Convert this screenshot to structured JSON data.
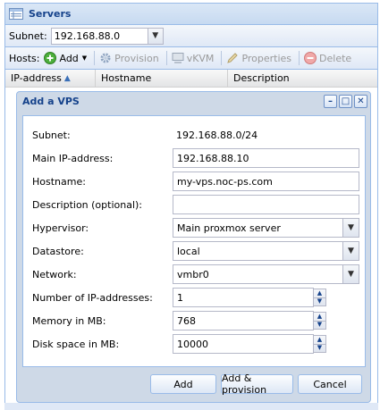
{
  "panel": {
    "title": "Servers"
  },
  "subnet_bar": {
    "label": "Subnet:",
    "value": "192.168.88.0"
  },
  "toolbar": {
    "hosts_label": "Hosts:",
    "add_label": "Add",
    "provision_label": "Provision",
    "vkvm_label": "vKVM",
    "properties_label": "Properties",
    "delete_label": "Delete"
  },
  "grid": {
    "columns": [
      "IP-address",
      "Hostname",
      "Description"
    ]
  },
  "dialog": {
    "title": "Add a VPS",
    "fields": {
      "subnet": {
        "label": "Subnet:",
        "value": "192.168.88.0/24"
      },
      "main_ip": {
        "label": "Main IP-address:",
        "value": "192.168.88.10"
      },
      "hostname": {
        "label": "Hostname:",
        "value": "my-vps.noc-ps.com"
      },
      "description": {
        "label": "Description (optional):",
        "value": ""
      },
      "hypervisor": {
        "label": "Hypervisor:",
        "value": "Main proxmox server"
      },
      "datastore": {
        "label": "Datastore:",
        "value": "local"
      },
      "network": {
        "label": "Network:",
        "value": "vmbr0"
      },
      "num_ips": {
        "label": "Number of IP-addresses:",
        "value": "1"
      },
      "memory": {
        "label": "Memory in MB:",
        "value": "768"
      },
      "disk": {
        "label": "Disk space in MB:",
        "value": "10000"
      }
    },
    "buttons": {
      "add": "Add",
      "add_provision": "Add & provision",
      "cancel": "Cancel"
    }
  },
  "colors": {
    "header_text": "#15428b",
    "border": "#99bbe8",
    "window_bg": "#ced9e7"
  },
  "icons": [
    "servers-icon",
    "add-icon",
    "provision-icon",
    "vkvm-icon",
    "properties-icon",
    "delete-icon",
    "minimize-icon",
    "maximize-icon",
    "close-icon"
  ]
}
